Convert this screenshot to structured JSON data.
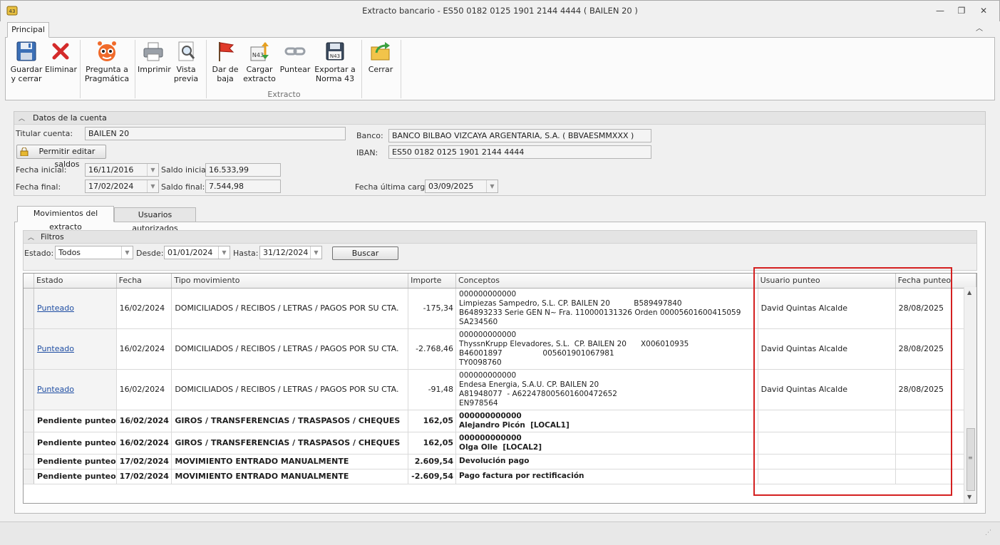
{
  "window": {
    "title": "Extracto bancario - ES50 0182 0125 1901 2144 4444 ( BAILEN 20             )",
    "minimize_glyph": "—",
    "restore_glyph": "❐",
    "close_glyph": "✕"
  },
  "ribbon": {
    "tab": "Principal",
    "collapse_glyph": "︿",
    "buttons": [
      {
        "id": "save",
        "label1": "Guardar",
        "label2": "y cerrar",
        "icon": "floppy-disk-icon"
      },
      {
        "id": "delete",
        "label1": "Eliminar",
        "label2": "",
        "icon": "red-x-icon"
      },
      {
        "id": "ask",
        "label1": "Pregunta a",
        "label2": "Pragmática",
        "icon": "robot-face-icon"
      },
      {
        "id": "print",
        "label1": "Imprimir",
        "label2": "",
        "icon": "printer-icon"
      },
      {
        "id": "preview",
        "label1": "Vista",
        "label2": "previa",
        "icon": "magnifier-page-icon"
      },
      {
        "id": "unsubscribe",
        "label1": "Dar de",
        "label2": "baja",
        "icon": "red-flag-icon"
      },
      {
        "id": "load",
        "label1": "Cargar",
        "label2": "extracto",
        "icon": "n43-arrows-icon"
      },
      {
        "id": "match",
        "label1": "Puntear",
        "label2": "",
        "icon": "chain-link-icon"
      },
      {
        "id": "export",
        "label1": "Exportar a",
        "label2": "Norma 43",
        "icon": "n43-save-icon"
      },
      {
        "id": "close",
        "label1": "Cerrar",
        "label2": "",
        "icon": "folder-arrow-icon"
      }
    ],
    "group_label": "Extracto"
  },
  "account": {
    "header": "Datos de la cuenta",
    "holder_label": "Titular cuenta:",
    "holder_value": "BAILEN 20",
    "edit_balances_button": "Permitir editar saldos",
    "bank_label": "Banco:",
    "bank_value": "BANCO BILBAO VIZCAYA ARGENTARIA, S.A. ( BBVAESMMXXX )",
    "iban_label": "IBAN:",
    "iban_value": "ES50 0182 0125 1901 2144 4444",
    "start_date_label": "Fecha inicial:",
    "start_date_value": "16/11/2016",
    "start_balance_label": "Saldo inicial:",
    "start_balance_value": "16.533,99",
    "end_date_label": "Fecha final:",
    "end_date_value": "17/02/2024",
    "end_balance_label": "Saldo final:",
    "end_balance_value": "7.544,98",
    "last_load_label": "Fecha última carga:",
    "last_load_value": "03/09/2025"
  },
  "tabs": [
    "Movimientos del extracto",
    "Usuarios autorizados"
  ],
  "filters": {
    "header": "Filtros",
    "state_label": "Estado:",
    "state_value": "Todos",
    "from_label": "Desde:",
    "from_value": "01/01/2024",
    "to_label": "Hasta:",
    "to_value": "31/12/2024",
    "search_button": "Buscar"
  },
  "grid": {
    "columns": [
      "Estado",
      "Fecha",
      "Tipo movimiento",
      "Importe",
      "Conceptos",
      "Usuario punteo",
      "Fecha punteo"
    ],
    "rows": [
      {
        "estado": "Punteado",
        "fecha": "16/02/2024",
        "tipo": "DOMICILIADOS / RECIBOS / LETRAS / PAGOS POR SU CTA.",
        "importe": "-175,34",
        "conceptos": "000000000000\nLimpiezas Sampedro, S.L. CP. BAILEN 20          B589497840\nB64893233 Serie GEN N~ Fra. 110000131326 Orden 00005601600415059\nSA234560",
        "usuario": "David Quintas Alcalde",
        "fecha_punteo": "28/08/2025"
      },
      {
        "estado": "Punteado",
        "fecha": "16/02/2024",
        "tipo": "DOMICILIADOS / RECIBOS / LETRAS / PAGOS POR SU CTA.",
        "importe": "-2.768,46",
        "conceptos": "000000000000\nThyssnKrupp Elevadores, S.L.  CP. BAILEN 20      X006010935\nB46001897                 005601901067981\nTY0098760",
        "usuario": "David Quintas Alcalde",
        "fecha_punteo": "28/08/2025"
      },
      {
        "estado": "Punteado",
        "fecha": "16/02/2024",
        "tipo": "DOMICILIADOS / RECIBOS / LETRAS / PAGOS POR SU CTA.",
        "importe": "-91,48",
        "conceptos": "000000000000\nEndesa Energia, S.A.U. CP. BAILEN 20\nA81948077  - A622478005601600472652\nEN978564",
        "usuario": "David Quintas Alcalde",
        "fecha_punteo": "28/08/2025"
      },
      {
        "estado": "Pendiente punteo",
        "fecha": "16/02/2024",
        "tipo": "GIROS / TRANSFERENCIAS / TRASPASOS / CHEQUES",
        "importe": "162,05",
        "conceptos": "000000000000\nAlejandro Picón  [LOCAL1]",
        "usuario": "",
        "fecha_punteo": ""
      },
      {
        "estado": "Pendiente punteo",
        "fecha": "16/02/2024",
        "tipo": "GIROS / TRANSFERENCIAS / TRASPASOS / CHEQUES",
        "importe": "162,05",
        "conceptos": "000000000000\nOlga Olle  [LOCAL2]",
        "usuario": "",
        "fecha_punteo": ""
      },
      {
        "estado": "Pendiente punteo",
        "fecha": "17/02/2024",
        "tipo": "MOVIMIENTO ENTRADO MANUALMENTE",
        "importe": "2.609,54",
        "conceptos": "Devolución pago",
        "usuario": "",
        "fecha_punteo": ""
      },
      {
        "estado": "Pendiente punteo",
        "fecha": "17/02/2024",
        "tipo": "MOVIMIENTO ENTRADO MANUALMENTE",
        "importe": "-2.609,54",
        "conceptos": "Pago factura por rectificación",
        "usuario": "",
        "fecha_punteo": ""
      }
    ]
  },
  "colors": {
    "highlight": "#d42020",
    "link": "#1f4ea3"
  }
}
